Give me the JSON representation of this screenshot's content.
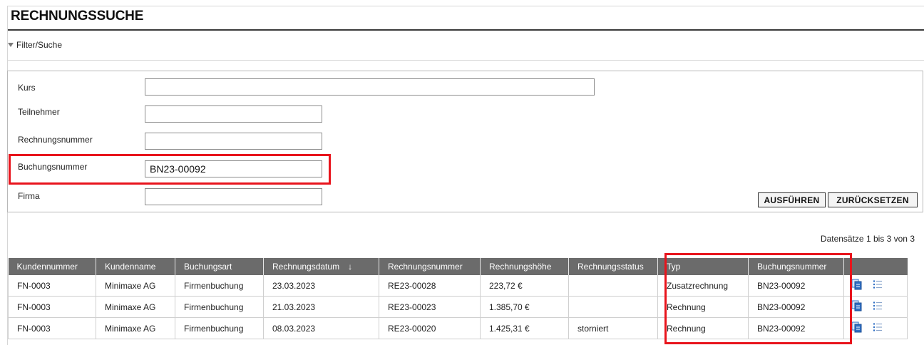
{
  "page": {
    "title": "RECHNUNGSSUCHE",
    "filter_toggle": "Filter/Suche"
  },
  "filter": {
    "kurs": {
      "label": "Kurs",
      "value": ""
    },
    "teilnehmer": {
      "label": "Teilnehmer",
      "value": ""
    },
    "rechnungsnummer": {
      "label": "Rechnungsnummer",
      "value": ""
    },
    "buchungsnummer": {
      "label": "Buchungsnummer",
      "value": "BN23-00092"
    },
    "firma": {
      "label": "Firma",
      "value": ""
    },
    "execute_label": "AUSFÜHREN",
    "reset_label": "ZURÜCKSETZEN"
  },
  "results": {
    "count_text": "Datensätze 1 bis 3 von 3",
    "columns": [
      "Kundennummer",
      "Kundenname",
      "Buchungsart",
      "Rechnungsdatum",
      "Rechnungsnummer",
      "Rechnungshöhe",
      "Rechnungsstatus",
      "Typ",
      "Buchungsnummer"
    ],
    "sort_indicator": "↓",
    "rows": [
      [
        "FN-0003",
        "Minimaxe AG",
        "Firmenbuchung",
        "23.03.2023",
        "RE23-00028",
        "223,72 €",
        "",
        "Zusatzrechnung",
        "BN23-00092"
      ],
      [
        "FN-0003",
        "Minimaxe AG",
        "Firmenbuchung",
        "21.03.2023",
        "RE23-00023",
        "1.385,70 €",
        "",
        "Rechnung",
        "BN23-00092"
      ],
      [
        "FN-0003",
        "Minimaxe AG",
        "Firmenbuchung",
        "08.03.2023",
        "RE23-00020",
        "1.425,31 €",
        "storniert",
        "Rechnung",
        "BN23-00092"
      ]
    ],
    "row_icons": [
      "document-copy-icon",
      "list-icon"
    ]
  },
  "colors": {
    "header_bg": "#6b6b6b",
    "highlight": "#e8141c",
    "icon_blue": "#2f6fc4"
  }
}
